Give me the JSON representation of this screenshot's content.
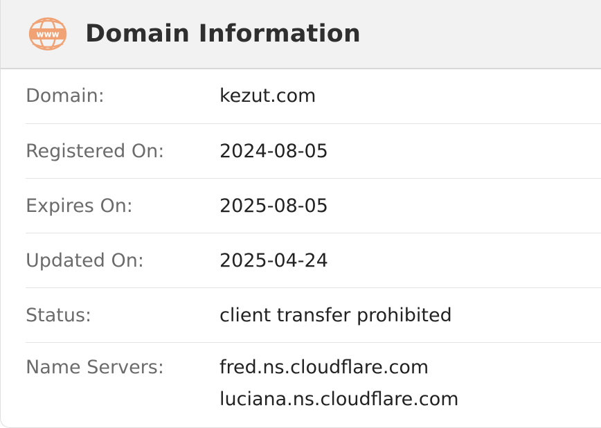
{
  "header": {
    "title": "Domain Information",
    "icon": "www-globe-icon",
    "icon_text": "www",
    "icon_color": "#f0a274"
  },
  "rows": [
    {
      "label": "Domain:",
      "value": "kezut.com"
    },
    {
      "label": "Registered On:",
      "value": "2024-08-05"
    },
    {
      "label": "Expires On:",
      "value": "2025-08-05"
    },
    {
      "label": "Updated On:",
      "value": "2025-04-24"
    },
    {
      "label": "Status:",
      "value": "client transfer prohibited"
    },
    {
      "label": "Name Servers:",
      "values": [
        "fred.ns.cloudflare.com",
        "luciana.ns.cloudflare.com"
      ]
    }
  ]
}
